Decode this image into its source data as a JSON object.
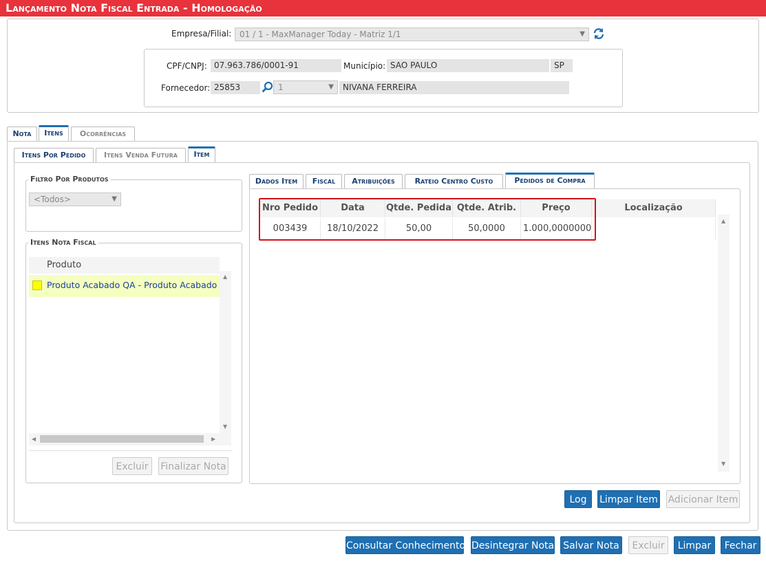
{
  "window": {
    "title": "Lançamento Nota Fiscal Entrada  - Homologação"
  },
  "header": {
    "empresa_label": "Empresa/Filial:",
    "empresa_value": "01 / 1 - MaxManager Today - Matriz 1/1",
    "cpf_label": "CPF/CNPJ:",
    "cpf_value": "07.963.786/0001-91",
    "municipio_label": "Município:",
    "municipio_value": "SAO PAULO",
    "uf_value": "SP",
    "fornecedor_label": "Fornecedor:",
    "fornecedor_code": "25853",
    "fornecedor_seq": "1",
    "fornecedor_name": "NIVANA FERREIRA"
  },
  "main_tabs": [
    {
      "label": "Nota"
    },
    {
      "label": "Itens"
    },
    {
      "label": "Ocorrências"
    }
  ],
  "sub_tabs": [
    {
      "label": "Itens Por Pedido"
    },
    {
      "label": "Itens Venda Futura"
    },
    {
      "label": "Item"
    }
  ],
  "filtro": {
    "legend": "Filtro Por Produtos",
    "select_value": "<Todos>"
  },
  "itens_nf": {
    "legend": "Itens Nota Fiscal",
    "column": "Produto",
    "rows": [
      {
        "produto": "Produto Acabado QA - Produto Acabado QA"
      }
    ],
    "excluir": "Excluir",
    "finalizar": "Finalizar Nota"
  },
  "detail_tabs": [
    {
      "label": "Dados Item"
    },
    {
      "label": "Fiscal"
    },
    {
      "label": "Atribuições"
    },
    {
      "label": "Rateio Centro Custo"
    },
    {
      "label": "Pedidos de Compra"
    }
  ],
  "pedidos_table": {
    "columns": [
      "Nro Pedido",
      "Data",
      "Qtde. Pedida",
      "Qtde. Atrib.",
      "Preço",
      "Localização"
    ],
    "rows": [
      {
        "nro": "003439",
        "data": "18/10/2022",
        "qtde_pedida": "50,00",
        "qtde_atrib": "50,0000",
        "preco": "1.000,00000000",
        "localizacao": ""
      }
    ],
    "highlight_color": "#d0121b"
  },
  "item_buttons": {
    "log": "Log",
    "limpar_item": "Limpar Item",
    "adicionar_item": "Adicionar Item"
  },
  "footer_buttons": {
    "consultar": "Consultar Conhecimento",
    "desintegrar": "Desintegrar Nota",
    "salvar": "Salvar Nota",
    "excluir": "Excluir",
    "limpar": "Limpar",
    "fechar": "Fechar"
  },
  "colors": {
    "title_bar": "#e8323c",
    "accent": "#1f6fb2",
    "row_highlight": "#f4ffc0",
    "marker": "#ffff00"
  }
}
